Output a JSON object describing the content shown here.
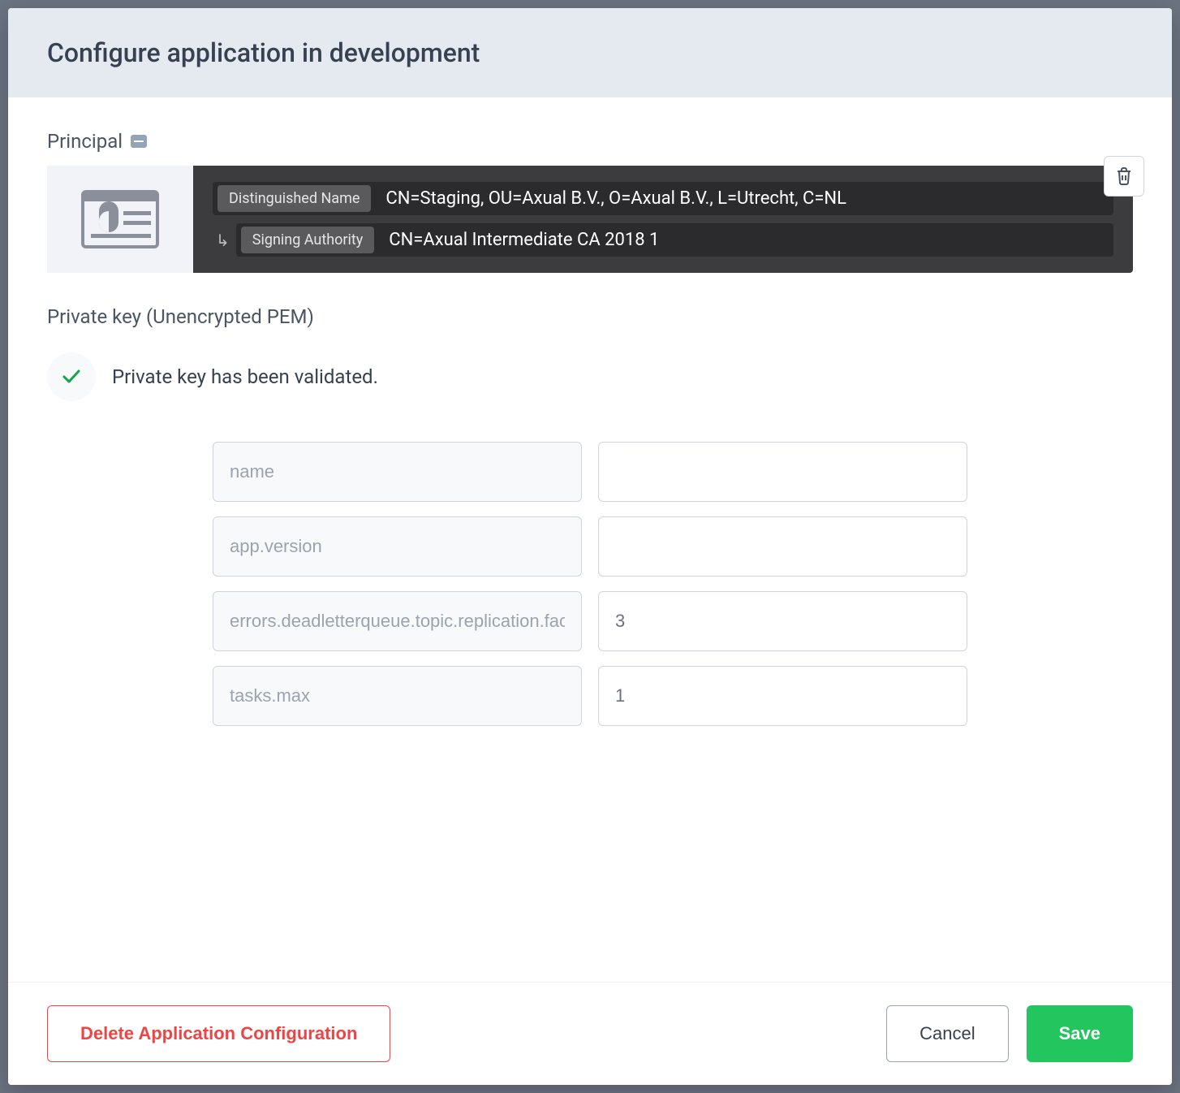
{
  "header": {
    "title": "Configure application in development"
  },
  "principal": {
    "label": "Principal",
    "distinguished_name_badge": "Distinguished Name",
    "distinguished_name_value": "CN=Staging, OU=Axual B.V., O=Axual B.V., L=Utrecht, C=NL",
    "signing_authority_badge": "Signing Authority",
    "signing_authority_value": "CN=Axual Intermediate CA 2018 1"
  },
  "private_key": {
    "heading": "Private key (Unencrypted PEM)",
    "validated_message": "Private key has been validated."
  },
  "config_rows": [
    {
      "key_placeholder": "name",
      "value": ""
    },
    {
      "key_placeholder": "app.version",
      "value": ""
    },
    {
      "key_placeholder": "errors.deadletterqueue.topic.replication.factor",
      "value": "3"
    },
    {
      "key_placeholder": "tasks.max",
      "value": "1"
    }
  ],
  "footer": {
    "delete": "Delete Application Configuration",
    "cancel": "Cancel",
    "save": "Save"
  }
}
